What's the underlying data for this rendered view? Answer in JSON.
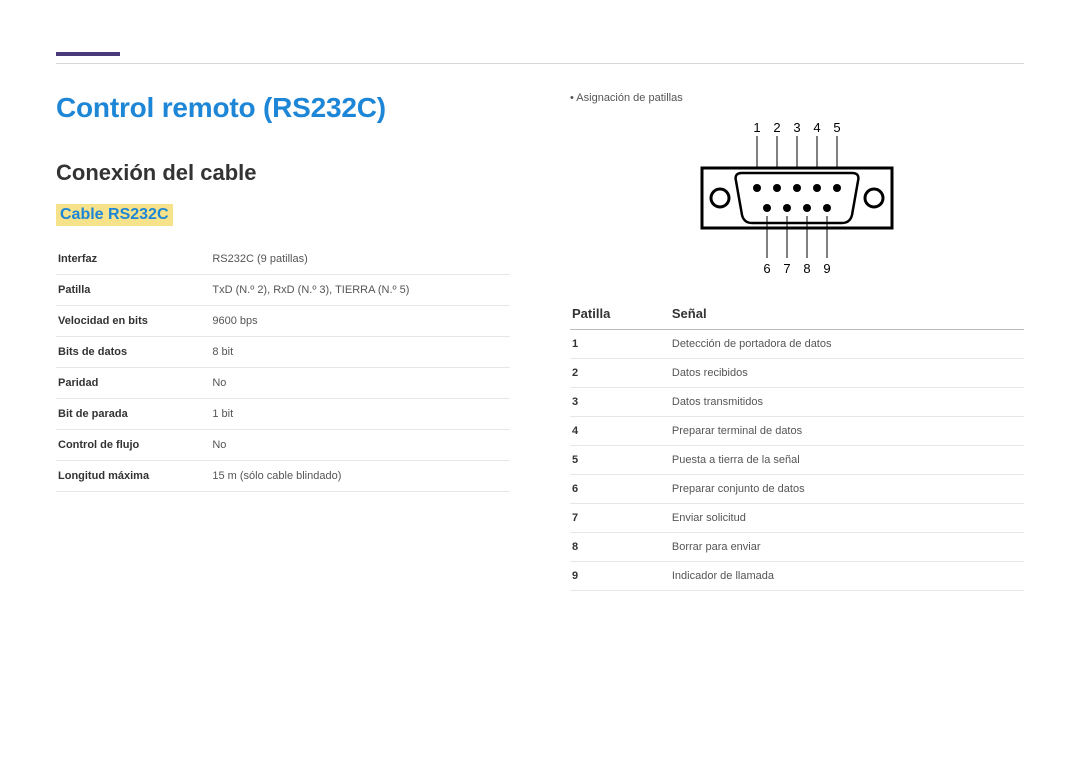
{
  "header": {
    "title": "Control remoto (RS232C)"
  },
  "left": {
    "section_heading": "Conexión del cable",
    "subsection_heading": "Cable RS232C",
    "specs": [
      {
        "label": "Interfaz",
        "value": "RS232C (9 patillas)"
      },
      {
        "label": "Patilla",
        "value": "TxD (N.º 2), RxD (N.º 3), TIERRA (N.º 5)"
      },
      {
        "label": "Velocidad en bits",
        "value": "9600 bps"
      },
      {
        "label": "Bits de datos",
        "value": "8 bit"
      },
      {
        "label": "Paridad",
        "value": "No"
      },
      {
        "label": "Bit de parada",
        "value": "1 bit"
      },
      {
        "label": "Control de flujo",
        "value": "No"
      },
      {
        "label": "Longitud máxima",
        "value": "15 m (sólo cable blindado)"
      }
    ]
  },
  "right": {
    "bullet": "• Asignación de patillas",
    "diagram": {
      "top_labels": [
        "1",
        "2",
        "3",
        "4",
        "5"
      ],
      "bottom_labels": [
        "6",
        "7",
        "8",
        "9"
      ]
    },
    "pin_table": {
      "head_pin": "Patilla",
      "head_signal": "Señal",
      "rows": [
        {
          "pin": "1",
          "signal": "Detección de portadora de datos"
        },
        {
          "pin": "2",
          "signal": "Datos recibidos"
        },
        {
          "pin": "3",
          "signal": "Datos transmitidos"
        },
        {
          "pin": "4",
          "signal": "Preparar terminal de datos"
        },
        {
          "pin": "5",
          "signal": "Puesta a tierra de la señal"
        },
        {
          "pin": "6",
          "signal": "Preparar conjunto de datos"
        },
        {
          "pin": "7",
          "signal": "Enviar solicitud"
        },
        {
          "pin": "8",
          "signal": "Borrar para enviar"
        },
        {
          "pin": "9",
          "signal": "Indicador de llamada"
        }
      ]
    }
  }
}
